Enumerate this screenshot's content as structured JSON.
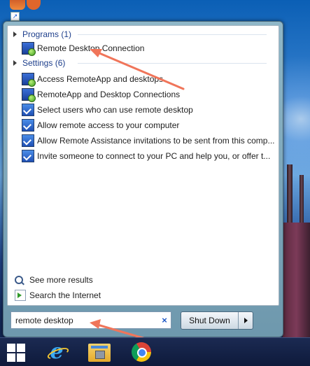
{
  "start_menu": {
    "groups": [
      {
        "header": "Programs (1)",
        "items": [
          {
            "label": "Remote Desktop Connection",
            "icon": "remote-desktop-icon"
          }
        ]
      },
      {
        "header": "Settings (6)",
        "items": [
          {
            "label": "Access RemoteApp and desktops",
            "icon": "remote-desktop-icon"
          },
          {
            "label": "RemoteApp and Desktop Connections",
            "icon": "remote-desktop-icon"
          },
          {
            "label": "Select users who can use remote desktop",
            "icon": "control-panel-icon"
          },
          {
            "label": "Allow remote access to your computer",
            "icon": "control-panel-icon"
          },
          {
            "label": "Allow Remote Assistance invitations to be sent from this comp...",
            "icon": "control-panel-icon"
          },
          {
            "label": "Invite someone to connect to your PC and help you, or offer t...",
            "icon": "control-panel-icon"
          }
        ]
      }
    ],
    "see_more_results": "See more results",
    "search_internet": "Search the Internet",
    "search": {
      "value": "remote desktop",
      "clear_glyph": "×"
    },
    "shutdown_label": "Shut Down"
  },
  "taskbar": {
    "items": [
      "start-button",
      "internet-explorer",
      "file-explorer",
      "google-chrome"
    ]
  },
  "colors": {
    "group_header": "#1e3f8c",
    "annotation_arrow": "#f0755a"
  }
}
